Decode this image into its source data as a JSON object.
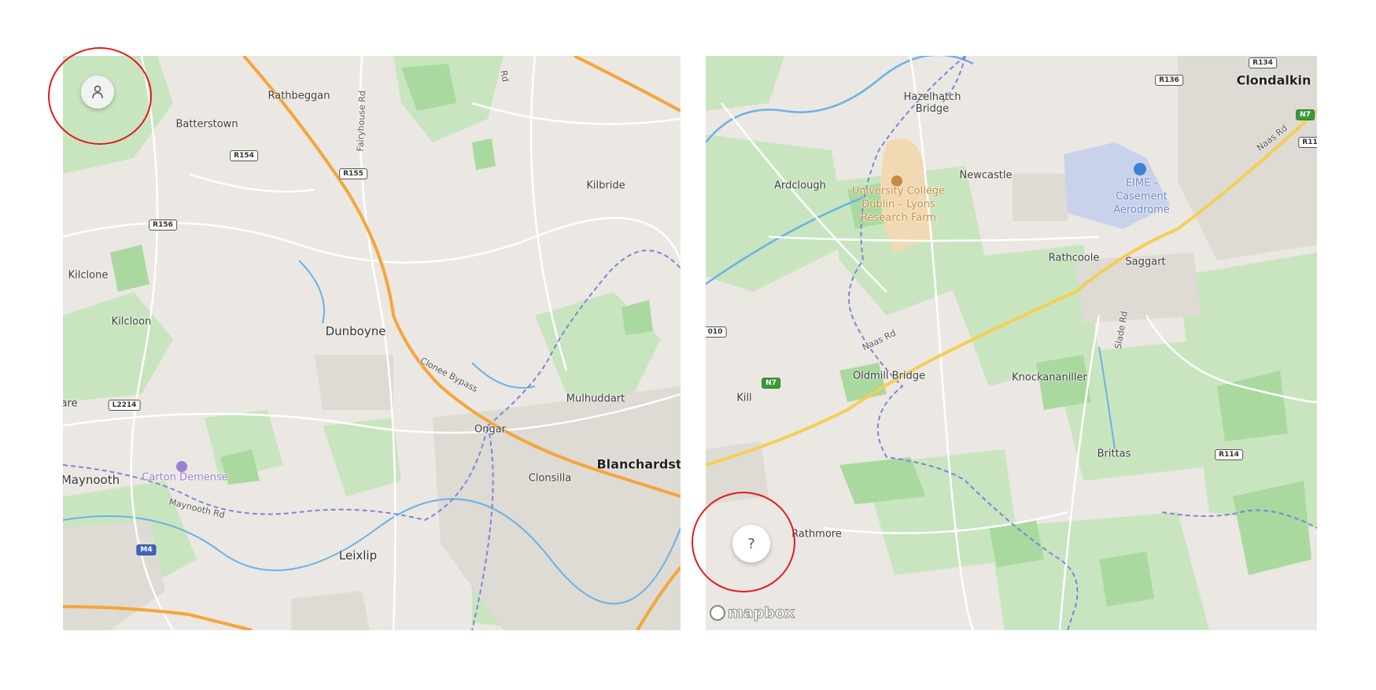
{
  "colors": {
    "land": "#ebe7e2",
    "park": "#c9e5c0",
    "forest": "#a9d99f",
    "motorway": "#f5a53b",
    "primary_road": "#f4cf55",
    "water": "#69b3e6",
    "boundary": "#7b86d6",
    "highlight_ring": "#e21b1b"
  },
  "left_map": {
    "places": {
      "rathbeggan": "Rathbeggan",
      "batterstown": "Batterstown",
      "kilbride": "Kilbride",
      "kilclone": "Kilclone",
      "kilcloon": "Kilcloon",
      "dunboyne": "Dunboyne",
      "mulhuddart": "Mulhuddart",
      "ongar": "Ongar",
      "clonsilla": "Clonsilla",
      "blanchardstown": "Blanchardsto",
      "maynooth": "Maynooth",
      "leixlip": "Leixlip",
      "clare_partial": "are",
      "carton_demesne": "Carton Demense"
    },
    "roads": {
      "fairyhouse": "Fairyhouse Rd",
      "rd_top": "Rd",
      "clonee_bypass": "Clonee Bypass",
      "maynooth_rd": "Maynooth Rd"
    },
    "shields": {
      "r154": "R154",
      "r155": "R155",
      "r156": "R156",
      "l2214": "L2214",
      "m4": "M4"
    },
    "profile_icon": "user-icon"
  },
  "right_map": {
    "places": {
      "hazelhatch": "Hazelhatch\nBridge",
      "clondalkin": "Clondalkin",
      "ardclough": "Ardclough",
      "newcastle": "Newcastle",
      "ucd_farm": "University College\nDublin – Lyons\nResearch Farm",
      "casement": "EIME -\nCasement\nAerodrome",
      "rathcoole": "Rathcoole",
      "saggart": "Saggart",
      "oldmill": "Oldmill Bridge",
      "knockananiller": "Knockananiller",
      "kill": "Kill",
      "brittas": "Brittas",
      "rathmore": "Rathmore"
    },
    "roads": {
      "naas_rd_1": "Naas Rd",
      "naas_rd_2": "Naas Rd",
      "slade_rd": "Slade Rd"
    },
    "shields": {
      "r134": "R134",
      "r136": "R136",
      "n7_top": "N7",
      "r11_partial": "R11",
      "r010_partial": "010",
      "n7": "N7",
      "r114": "R114"
    },
    "help_label": "?",
    "attribution": "mapbox"
  }
}
